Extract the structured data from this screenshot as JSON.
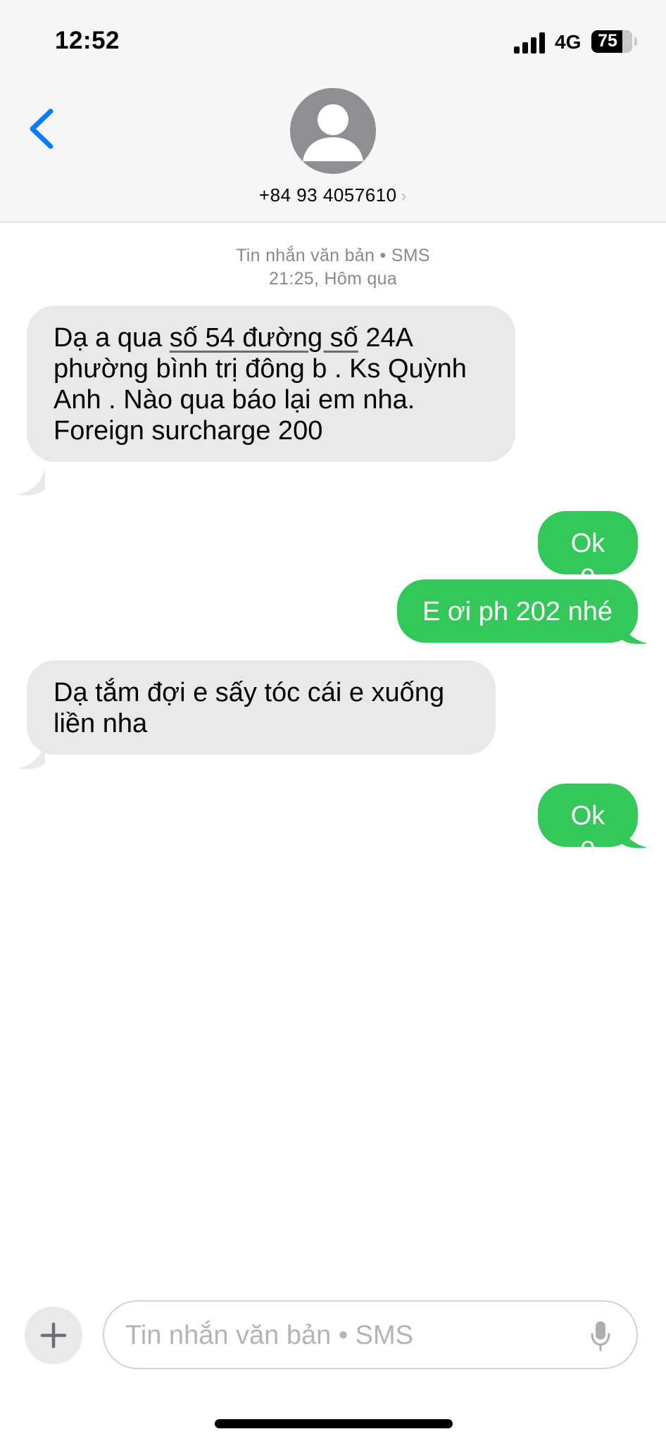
{
  "status_bar": {
    "time": "12:52",
    "network": "4G",
    "battery": "75",
    "battery_level": 0.75
  },
  "header": {
    "contact": "+84 93 4057610",
    "contact_chevron": "›",
    "back_icon": "chevron-left-icon",
    "avatar_icon": "person-icon"
  },
  "thread": {
    "service": "Tin nhắn văn bản • SMS",
    "timestamp": "21:25, Hôm qua"
  },
  "messages": [
    {
      "direction": "incoming",
      "parts": [
        "Dạ a qua ",
        "số 54 đường số",
        " 24A phường bình trị đông b . Ks Quỳnh Anh . Nào qua báo lại em nha. Foreign surcharge 200"
      ]
    },
    {
      "direction": "outgoing",
      "text": "Ok e"
    },
    {
      "direction": "outgoing",
      "text": "E ơi ph 202 nhé"
    },
    {
      "direction": "incoming",
      "text": "Dạ tắm đợi e sấy tóc cái e xuống liền nha"
    },
    {
      "direction": "outgoing",
      "text": "Ok e"
    }
  ],
  "composer": {
    "placeholder": "Tin nhắn văn bản • SMS",
    "value": "",
    "plus_icon": "plus-icon",
    "mic_icon": "microphone-icon"
  },
  "colors": {
    "incoming_bubble": "#e9e9eb",
    "outgoing_bubble": "#34c759",
    "accent": "#0a7aff",
    "header_bg": "#f6f6f6"
  }
}
